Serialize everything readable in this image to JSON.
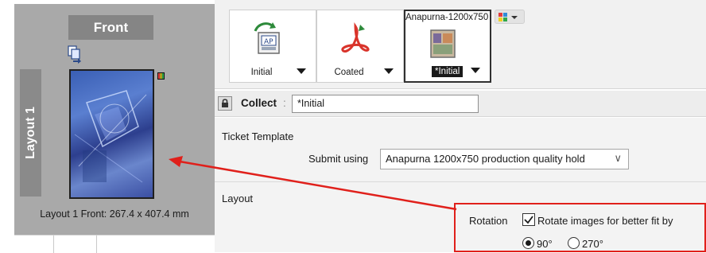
{
  "left": {
    "front_label": "Front",
    "layout_tab_label": "Layout 1",
    "layout_info": "Layout 1 Front: 267.4 x 407.4 mm"
  },
  "workflow": {
    "steps": [
      {
        "label": "Initial",
        "icon": "print-app-icon"
      },
      {
        "label": "Coated",
        "icon": "pdf-curve-icon"
      },
      {
        "label": "*Initial",
        "icon": "image-preset-icon",
        "preset": "Anapurna-1200x750",
        "selected": true
      }
    ],
    "color_switch_icon": "color-swatch-icon"
  },
  "collect": {
    "label": "Collect",
    "colon": ":",
    "value": "*Initial"
  },
  "settings": {
    "ticket_template_heading": "Ticket Template",
    "submit_label": "Submit using",
    "submit_value": "Anapurna 1200x750 production quality hold",
    "layout_heading": "Layout",
    "rotation_label": "Rotation",
    "rotate_checkbox_label": "Rotate images for better fit by",
    "rotate_checked": true,
    "radio_options": [
      "90°",
      "270°"
    ],
    "radio_selected": "90°"
  },
  "colors": {
    "callout": "#e0201b",
    "preview_bg": "#a9a9a9",
    "tab_gray": "#858585"
  }
}
